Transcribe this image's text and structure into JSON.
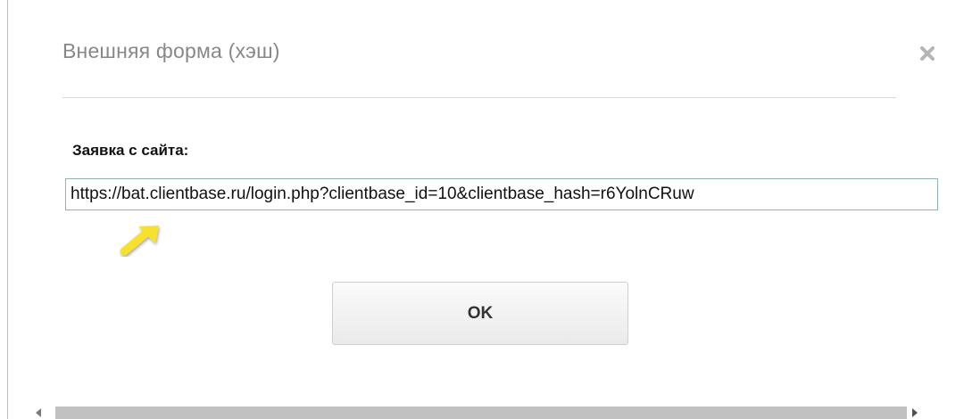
{
  "dialog": {
    "title": "Внешняя форма (хэш)",
    "close_icon": "close-icon"
  },
  "form": {
    "label": "Заявка с сайта:",
    "url_value": "https://bat.clientbase.ru/login.php?clientbase_id=10&clientbase_hash=r6YolnCRuw"
  },
  "annotation": {
    "icon": "pointer-arrow-icon",
    "color": "#f7e12a"
  },
  "buttons": {
    "ok_label": "OK"
  },
  "scrollbar": {
    "left_icon": "scroll-left-arrow-icon",
    "right_icon": "scroll-right-arrow-icon",
    "position": 0.0
  }
}
